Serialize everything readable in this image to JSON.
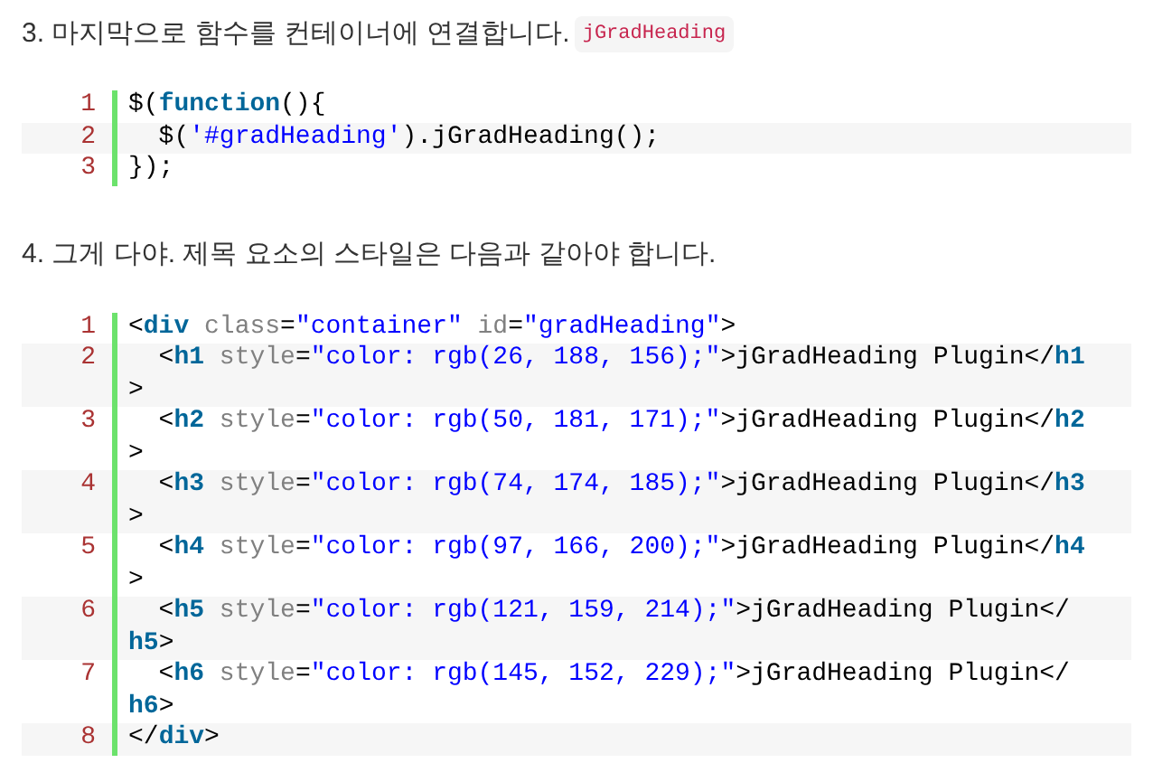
{
  "steps": [
    {
      "text": "3. 마지막으로 함수를 컨테이너에 연결합니다.",
      "inline_code": "jGradHeading",
      "code_lines": [
        {
          "number": "1",
          "tokens": [
            {
              "kind": "plain",
              "text": "$("
            },
            {
              "kind": "keyword",
              "text": "function"
            },
            {
              "kind": "plain",
              "text": "(){"
            }
          ]
        },
        {
          "number": "2",
          "tokens": [
            {
              "kind": "plain",
              "text": "  $("
            },
            {
              "kind": "string",
              "text": "'#gradHeading'"
            },
            {
              "kind": "plain",
              "text": ").jGradHeading();"
            }
          ]
        },
        {
          "number": "3",
          "tokens": [
            {
              "kind": "plain",
              "text": "});"
            }
          ]
        }
      ]
    },
    {
      "text": "4. 그게 다야. 제목 요소의 스타일은 다음과 같아야 합니다.",
      "code_lines": [
        {
          "number": "1",
          "tokens": [
            {
              "kind": "plain",
              "text": "<"
            },
            {
              "kind": "keyword",
              "text": "div"
            },
            {
              "kind": "attr",
              "text": " class"
            },
            {
              "kind": "plain",
              "text": "="
            },
            {
              "kind": "string",
              "text": "\"container\""
            },
            {
              "kind": "attr",
              "text": " id"
            },
            {
              "kind": "plain",
              "text": "="
            },
            {
              "kind": "string",
              "text": "\"gradHeading\""
            },
            {
              "kind": "plain",
              "text": ">"
            }
          ]
        },
        {
          "number": "2",
          "tokens": [
            {
              "kind": "plain",
              "text": "  <"
            },
            {
              "kind": "keyword",
              "text": "h1"
            },
            {
              "kind": "attr",
              "text": " style"
            },
            {
              "kind": "plain",
              "text": "="
            },
            {
              "kind": "string",
              "text": "\"color: rgb(26, 188, 156);\""
            },
            {
              "kind": "plain",
              "text": ">jGradHeading Plugin</"
            },
            {
              "kind": "keyword",
              "text": "h1"
            },
            {
              "kind": "wrap"
            },
            {
              "kind": "plain",
              "text": ">"
            }
          ]
        },
        {
          "number": "3",
          "tokens": [
            {
              "kind": "plain",
              "text": "  <"
            },
            {
              "kind": "keyword",
              "text": "h2"
            },
            {
              "kind": "attr",
              "text": " style"
            },
            {
              "kind": "plain",
              "text": "="
            },
            {
              "kind": "string",
              "text": "\"color: rgb(50, 181, 171);\""
            },
            {
              "kind": "plain",
              "text": ">jGradHeading Plugin</"
            },
            {
              "kind": "keyword",
              "text": "h2"
            },
            {
              "kind": "wrap"
            },
            {
              "kind": "plain",
              "text": ">"
            }
          ]
        },
        {
          "number": "4",
          "tokens": [
            {
              "kind": "plain",
              "text": "  <"
            },
            {
              "kind": "keyword",
              "text": "h3"
            },
            {
              "kind": "attr",
              "text": " style"
            },
            {
              "kind": "plain",
              "text": "="
            },
            {
              "kind": "string",
              "text": "\"color: rgb(74, 174, 185);\""
            },
            {
              "kind": "plain",
              "text": ">jGradHeading Plugin</"
            },
            {
              "kind": "keyword",
              "text": "h3"
            },
            {
              "kind": "wrap"
            },
            {
              "kind": "plain",
              "text": ">"
            }
          ]
        },
        {
          "number": "5",
          "tokens": [
            {
              "kind": "plain",
              "text": "  <"
            },
            {
              "kind": "keyword",
              "text": "h4"
            },
            {
              "kind": "attr",
              "text": " style"
            },
            {
              "kind": "plain",
              "text": "="
            },
            {
              "kind": "string",
              "text": "\"color: rgb(97, 166, 200);\""
            },
            {
              "kind": "plain",
              "text": ">jGradHeading Plugin</"
            },
            {
              "kind": "keyword",
              "text": "h4"
            },
            {
              "kind": "wrap"
            },
            {
              "kind": "plain",
              "text": ">"
            }
          ]
        },
        {
          "number": "6",
          "tokens": [
            {
              "kind": "plain",
              "text": "  <"
            },
            {
              "kind": "keyword",
              "text": "h5"
            },
            {
              "kind": "attr",
              "text": " style"
            },
            {
              "kind": "plain",
              "text": "="
            },
            {
              "kind": "string",
              "text": "\"color: rgb(121, 159, 214);\""
            },
            {
              "kind": "plain",
              "text": ">jGradHeading Plugin</"
            },
            {
              "kind": "wrap"
            },
            {
              "kind": "keyword",
              "text": "h5"
            },
            {
              "kind": "plain",
              "text": ">"
            }
          ]
        },
        {
          "number": "7",
          "tokens": [
            {
              "kind": "plain",
              "text": "  <"
            },
            {
              "kind": "keyword",
              "text": "h6"
            },
            {
              "kind": "attr",
              "text": " style"
            },
            {
              "kind": "plain",
              "text": "="
            },
            {
              "kind": "string",
              "text": "\"color: rgb(145, 152, 229);\""
            },
            {
              "kind": "plain",
              "text": ">jGradHeading Plugin</"
            },
            {
              "kind": "wrap"
            },
            {
              "kind": "keyword",
              "text": "h6"
            },
            {
              "kind": "plain",
              "text": ">"
            }
          ]
        },
        {
          "number": "8",
          "tokens": [
            {
              "kind": "plain",
              "text": "</"
            },
            {
              "kind": "keyword",
              "text": "div"
            },
            {
              "kind": "plain",
              "text": ">"
            }
          ]
        }
      ]
    }
  ]
}
